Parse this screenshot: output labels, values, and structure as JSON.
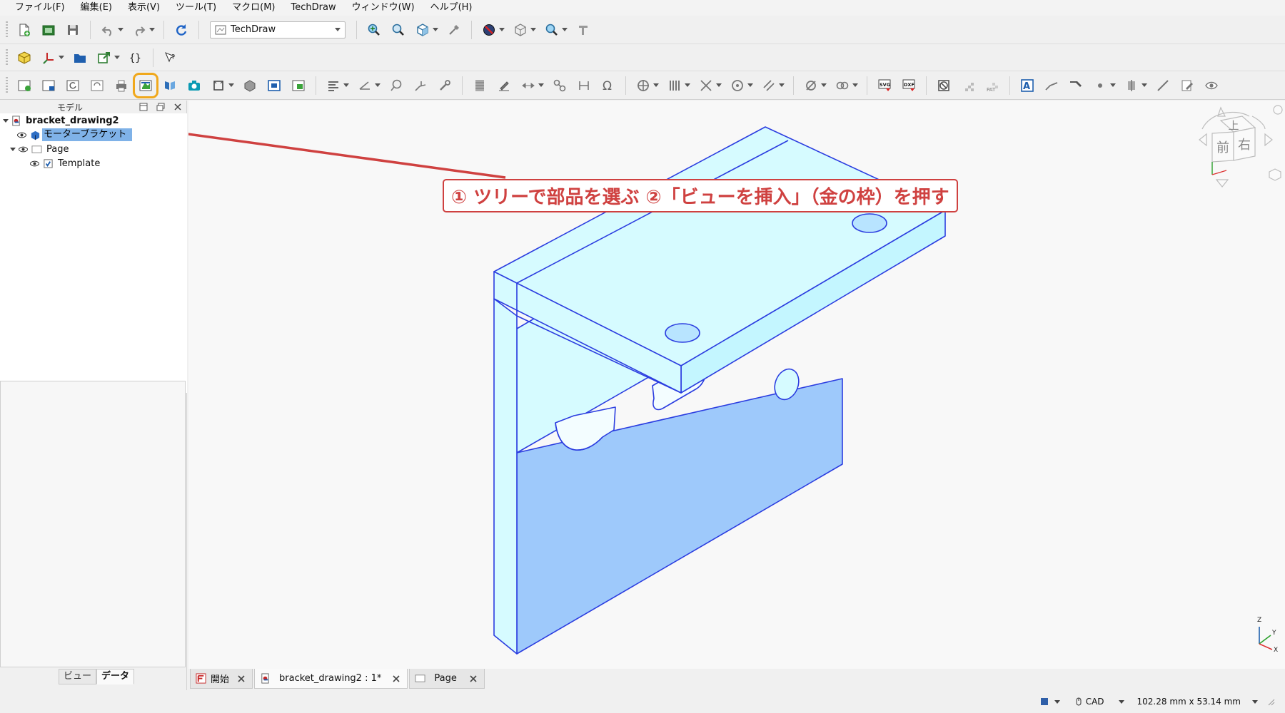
{
  "menu": [
    "ファイル(F)",
    "編集(E)",
    "表示(V)",
    "ツール(T)",
    "マクロ(M)",
    "TechDraw",
    "ウィンドウ(W)",
    "ヘルプ(H)"
  ],
  "toolbar": {
    "workbench": "TechDraw",
    "highlighted_button": "insert-view-button"
  },
  "panel": {
    "title": "モデル",
    "tabs": {
      "view": "ビュー",
      "data": "データ"
    }
  },
  "tree": {
    "document": "bracket_drawing2",
    "part": "モーターブラケット",
    "page": "Page",
    "template": "Template"
  },
  "annotation": {
    "callout": "① ツリーで部品を選ぶ ②「ビューを挿入」（金の枠）を押す",
    "color": "#cf4140"
  },
  "navcube": {
    "top": "上",
    "front": "前",
    "right": "右"
  },
  "axis": {
    "x": "X",
    "y": "Y",
    "z": "Z"
  },
  "doc_tabs": [
    {
      "label": "開始"
    },
    {
      "label": "bracket_drawing2 : 1*"
    },
    {
      "label": "Page"
    }
  ],
  "status": {
    "nav_style": "CAD",
    "dimensions": "102.28 mm x 53.14 mm"
  },
  "colors": {
    "selection": "#7fb2e8",
    "highlight_frame": "#f0a81c",
    "model_edge": "#2b3de0",
    "model_light": "#d6fbff",
    "model_dark": "#9ec9fb"
  }
}
